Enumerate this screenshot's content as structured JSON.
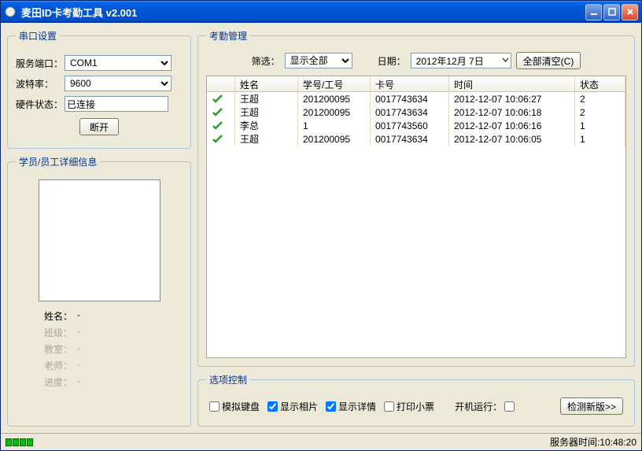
{
  "window": {
    "title": "麦田ID卡考勤工具  v2.001"
  },
  "serial": {
    "legend": "串口设置",
    "port_label": "服务端口：",
    "port_value": "COM1",
    "baud_label": "波特率：",
    "baud_value": "9600",
    "hw_label": "硬件状态：",
    "hw_value": "已连接",
    "disconnect_btn": "断开"
  },
  "detail": {
    "legend": "学员/员工详细信息",
    "name_label": "姓名：",
    "name_value": "-",
    "class_label": "班级：",
    "class_value": "-",
    "room_label": "教室：",
    "room_value": "-",
    "teacher_label": "老师：",
    "teacher_value": "-",
    "progress_label": "进度：",
    "progress_value": "-"
  },
  "attendance": {
    "legend": "考勤管理",
    "filter_label": "筛选：",
    "filter_value": "显示全部",
    "date_label": "日期：",
    "date_value": "2012年12月 7日",
    "clear_btn": "全部清空(C)",
    "columns": {
      "name": "姓名",
      "sid": "学号/工号",
      "card": "卡号",
      "time": "时间",
      "status": "状态"
    },
    "rows": [
      {
        "name": "王超",
        "sid": "201200095",
        "card": "0017743634",
        "time": "2012-12-07 10:06:27",
        "status": "2"
      },
      {
        "name": "王超",
        "sid": "201200095",
        "card": "0017743634",
        "time": "2012-12-07 10:06:18",
        "status": "2"
      },
      {
        "name": "李总",
        "sid": "1",
        "card": "0017743560",
        "time": "2012-12-07 10:06:16",
        "status": "1"
      },
      {
        "name": "王超",
        "sid": "201200095",
        "card": "0017743634",
        "time": "2012-12-07 10:06:05",
        "status": "1"
      }
    ]
  },
  "options": {
    "legend": "选项控制",
    "sim_keyboard": "模拟键盘",
    "show_photo": "显示相片",
    "show_detail": "显示详情",
    "print_ticket": "打印小票",
    "autorun": "开机运行：",
    "check_update": "检测新版>>"
  },
  "status": {
    "server_time_label": "服务器时间:",
    "server_time_value": "10:48:20"
  }
}
